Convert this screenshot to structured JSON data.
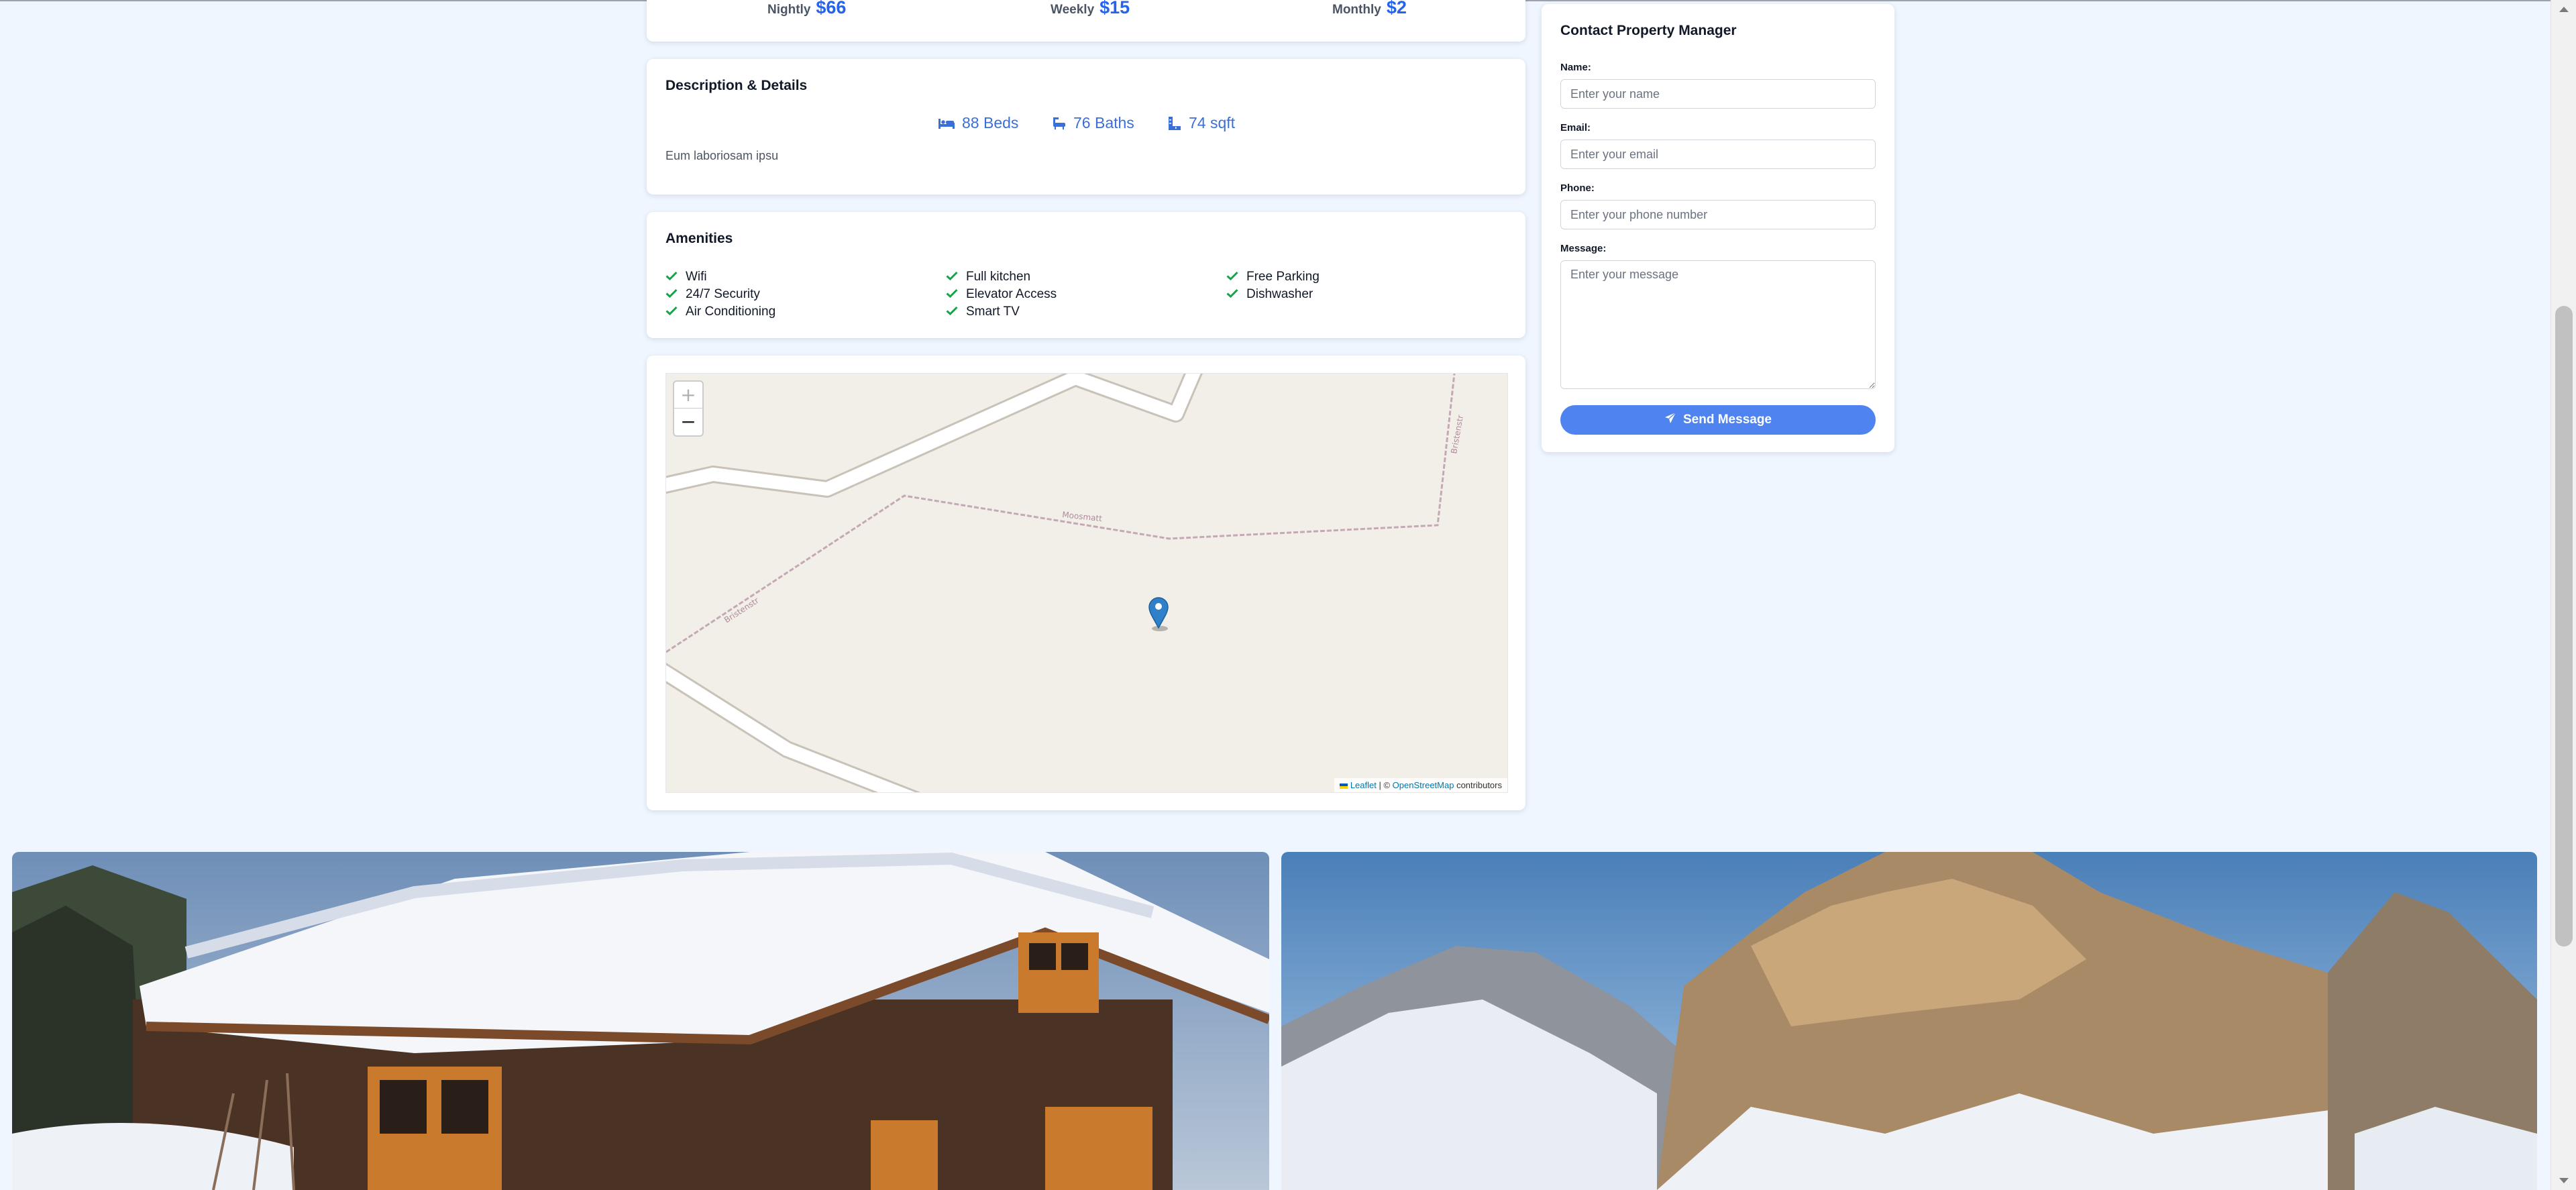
{
  "prices": [
    {
      "label": "Nightly",
      "value": "$66"
    },
    {
      "label": "Weekly",
      "value": "$15"
    },
    {
      "label": "Monthly",
      "value": "$2"
    }
  ],
  "description": {
    "title": "Description & Details",
    "beds": "88 Beds",
    "baths": "76 Baths",
    "area": "74 sqft",
    "text": "Eum laboriosam ipsu"
  },
  "amenities": {
    "title": "Amenities",
    "items": [
      "Wifi",
      "Full kitchen",
      "Free Parking",
      "24/7 Security",
      "Elevator Access",
      "Dishwasher",
      "Air Conditioning",
      "Smart TV"
    ]
  },
  "map": {
    "zoom_in": "+",
    "zoom_out": "−",
    "street_1": "Moosmatt",
    "street_2": "Bristenstr",
    "street_3": "Bristenstr",
    "attribution": {
      "leaflet": "Leaflet",
      "separator": " | © ",
      "osm": "OpenStreetMap",
      "contributors": " contributors"
    }
  },
  "contact": {
    "title": "Contact Property Manager",
    "name_label": "Name:",
    "name_placeholder": "Enter your name",
    "email_label": "Email:",
    "email_placeholder": "Enter your email",
    "phone_label": "Phone:",
    "phone_placeholder": "Enter your phone number",
    "message_label": "Message:",
    "message_placeholder": "Enter your message",
    "send_label": "Send Message"
  },
  "colors": {
    "accent": "#4f84f0",
    "page_bg": "#eff6ff",
    "check": "#16a34a"
  }
}
